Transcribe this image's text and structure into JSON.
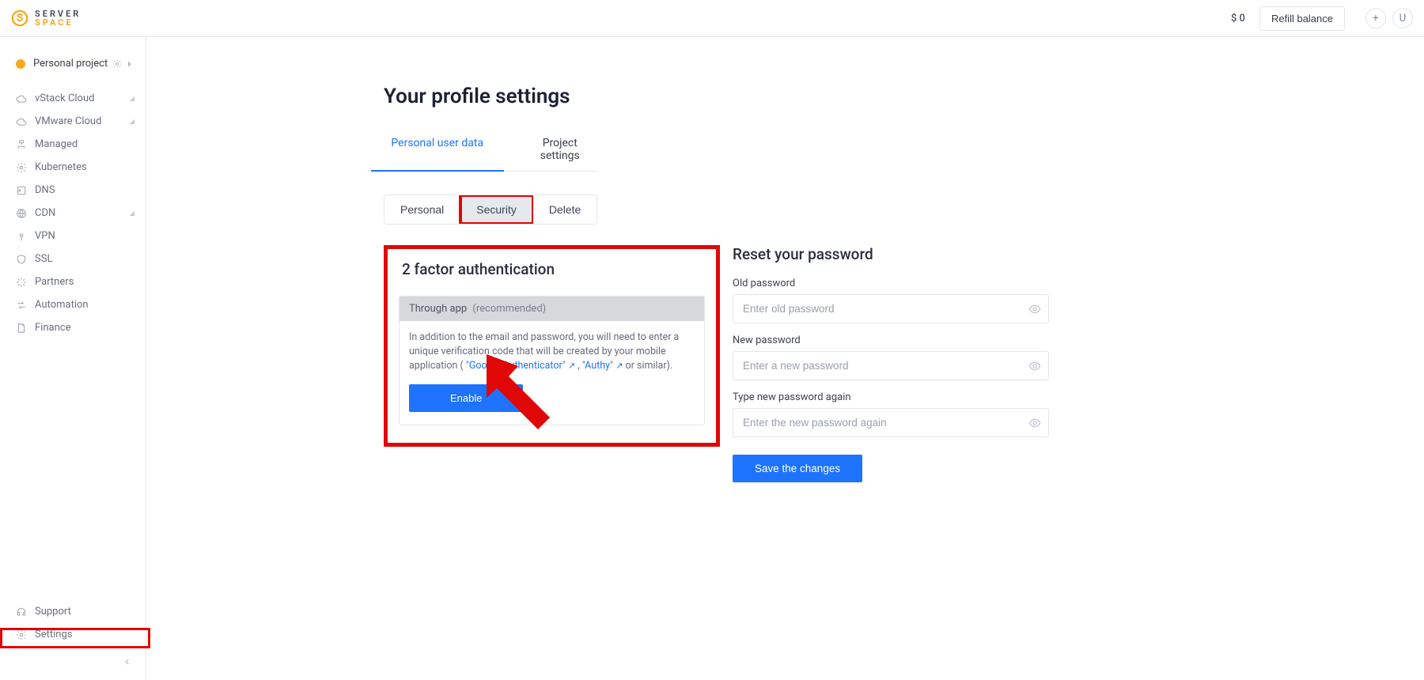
{
  "header": {
    "logo_line1": "SERVER",
    "logo_line2": "SPACE",
    "balance": "$ 0",
    "refill_label": "Refill balance",
    "plus_glyph": "+",
    "avatar_letter": "U"
  },
  "sidebar": {
    "project_label": "Personal project",
    "items": [
      {
        "label": "vStack Cloud",
        "icon": "cloud-down-icon",
        "caret": true
      },
      {
        "label": "VMware Cloud",
        "icon": "cloud-icon",
        "caret": true
      },
      {
        "label": "Managed",
        "icon": "managed-icon",
        "caret": false
      },
      {
        "label": "Kubernetes",
        "icon": "gear-icon",
        "caret": false
      },
      {
        "label": "DNS",
        "icon": "dns-icon",
        "caret": false
      },
      {
        "label": "CDN",
        "icon": "cdn-icon",
        "caret": true
      },
      {
        "label": "VPN",
        "icon": "vpn-icon",
        "caret": false
      },
      {
        "label": "SSL",
        "icon": "shield-icon",
        "caret": false
      },
      {
        "label": "Partners",
        "icon": "partners-icon",
        "caret": false
      },
      {
        "label": "Automation",
        "icon": "automation-icon",
        "caret": false
      },
      {
        "label": "Finance",
        "icon": "finance-icon",
        "caret": false
      }
    ],
    "bottom_items": [
      {
        "label": "Support",
        "icon": "support-icon"
      },
      {
        "label": "Settings",
        "icon": "settings-gear-icon"
      }
    ]
  },
  "main": {
    "title": "Your profile settings",
    "tabs": [
      {
        "label": "Personal user data",
        "active": true
      },
      {
        "label": "Project settings",
        "active": false
      }
    ],
    "subtabs": [
      {
        "label": "Personal",
        "active": false
      },
      {
        "label": "Security",
        "active": true
      },
      {
        "label": "Delete",
        "active": false
      }
    ],
    "twofa": {
      "heading": "2 factor authentication",
      "method": "Through app",
      "recommended": "(recommended)",
      "desc_pre": "In addition to the email and password, you will need to enter a unique verification code that will be created by your mobile application ( ",
      "link1": "\"Google Authenticator\"",
      "sep": ", ",
      "link2": "\"Authy\"",
      "desc_post": " or similar).",
      "enable_label": "Enable"
    },
    "reset": {
      "heading": "Reset your password",
      "old_label": "Old password",
      "old_placeholder": "Enter old password",
      "new_label": "New password",
      "new_placeholder": "Enter a new password",
      "again_label": "Type new password again",
      "again_placeholder": "Enter the new password again",
      "save_label": "Save the changes"
    }
  }
}
